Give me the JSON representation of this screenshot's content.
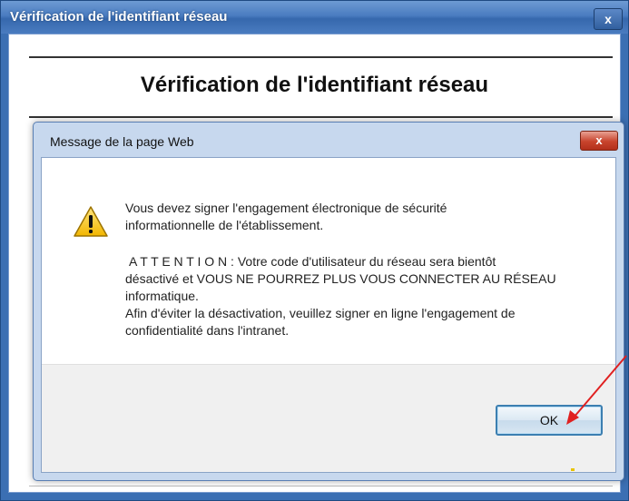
{
  "outer_window": {
    "title": "Vérification de l'identifiant réseau",
    "close_glyph": "x",
    "heading": "Vérification de l'identifiant réseau"
  },
  "dialog": {
    "title": "Message de la page Web",
    "close_glyph": "x",
    "icon": "warning-icon",
    "message": {
      "line1": "Vous devez signer l'engagement électronique de sécurité",
      "line2": "informationnelle de l'établissement.",
      "attention_label": "A T T E N T I O N",
      "attention_rest": " : Votre code d'utilisateur du réseau sera bientôt",
      "line4": "désactivé et VOUS NE POURREZ PLUS VOUS CONNECTER AU RÉSEAU",
      "line5": "informatique.",
      "line6": "Afin d'éviter la désactivation, veuillez signer en ligne l'engagement de",
      "line7": "confidentialité dans l'intranet."
    },
    "ok_label": "OK"
  },
  "colors": {
    "window_blue": "#3b6fb3",
    "dialog_frame": "#c7d8ee",
    "close_red": "#c8432c",
    "arrow_red": "#e02020",
    "ok_border": "#3c7fb1"
  }
}
